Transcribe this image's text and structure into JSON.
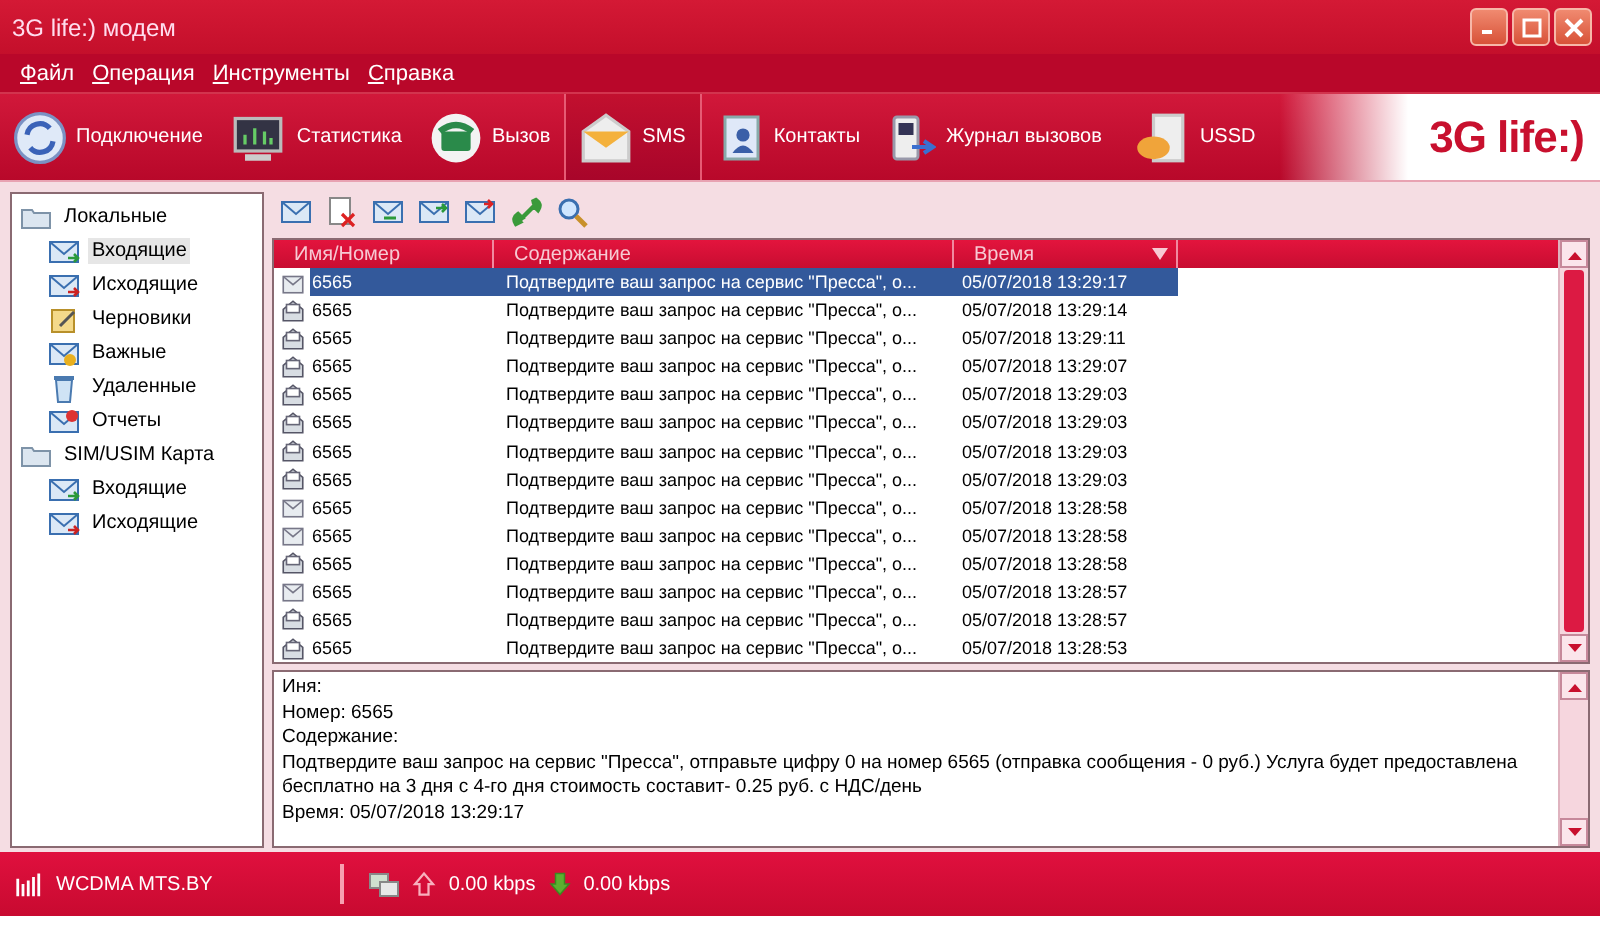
{
  "window": {
    "title": "3G life:) модем"
  },
  "menu": [
    "Файл",
    "Операция",
    "Инструменты",
    "Справка"
  ],
  "toolbar": [
    {
      "label": "Подключение",
      "kind": "connect",
      "selected": false
    },
    {
      "label": "Статистика",
      "kind": "stats",
      "selected": false
    },
    {
      "label": "Вызов",
      "kind": "call",
      "selected": false
    },
    {
      "label": "SMS",
      "kind": "sms",
      "selected": true
    },
    {
      "label": "Контакты",
      "kind": "contacts",
      "selected": false
    },
    {
      "label": "Журнал вызовов",
      "kind": "log",
      "selected": false
    },
    {
      "label": "USSD",
      "kind": "ussd",
      "selected": false
    }
  ],
  "logo": "3G life:)",
  "sidebar": {
    "items": [
      {
        "label": "Локальные",
        "kind": "folder",
        "selected": false,
        "children": [
          {
            "label": "Входящие",
            "kind": "inbox",
            "selected": true
          },
          {
            "label": "Исходящие",
            "kind": "outbox",
            "selected": false
          },
          {
            "label": "Черновики",
            "kind": "drafts",
            "selected": false
          },
          {
            "label": "Важные",
            "kind": "important",
            "selected": false
          },
          {
            "label": "Удаленные",
            "kind": "trash",
            "selected": false
          },
          {
            "label": "Отчеты",
            "kind": "reports",
            "selected": false
          }
        ]
      },
      {
        "label": "SIM/USIM Карта",
        "kind": "folder",
        "selected": false,
        "children": [
          {
            "label": "Входящие",
            "kind": "inbox",
            "selected": false
          },
          {
            "label": "Исходящие",
            "kind": "outbox",
            "selected": false
          }
        ]
      }
    ]
  },
  "table": {
    "columns": [
      "Имя/Номер",
      "Содержание",
      "Время"
    ],
    "rows": [
      {
        "name": "6565",
        "content": "Подтвердите ваш запрос на сервис \"Пресса\", о...",
        "time": "05/07/2018 13:29:17",
        "read": false,
        "selected": true
      },
      {
        "name": "6565",
        "content": "Подтвердите ваш запрос на сервис \"Пресса\", о...",
        "time": "05/07/2018 13:29:14",
        "read": true,
        "selected": false
      },
      {
        "name": "6565",
        "content": "Подтвердите ваш запрос на сервис \"Пресса\", о...",
        "time": "05/07/2018 13:29:11",
        "read": true,
        "selected": false
      },
      {
        "name": "6565",
        "content": "Подтвердите ваш запрос на сервис \"Пресса\", о...",
        "time": "05/07/2018 13:29:07",
        "read": true,
        "selected": false
      },
      {
        "name": "6565",
        "content": "Подтвердите ваш запрос на сервис \"Пресса\", о...",
        "time": "05/07/2018 13:29:03",
        "read": true,
        "selected": false
      },
      {
        "name": "6565",
        "content": "Подтвердите ваш запрос на сервис \"Пресса\", о...",
        "time": "05/07/2018 13:29:03",
        "read": true,
        "selected": false
      },
      {
        "name": "6565",
        "content": "Подтвердите ваш запрос на сервис \"Пресса\", о...",
        "time": "05/07/2018 13:29:03",
        "read": true,
        "selected": false
      },
      {
        "name": "6565",
        "content": "Подтвердите ваш запрос на сервис \"Пресса\", о...",
        "time": "05/07/2018 13:29:03",
        "read": true,
        "selected": false
      },
      {
        "name": "6565",
        "content": "Подтвердите ваш запрос на сервис \"Пресса\", о...",
        "time": "05/07/2018 13:28:58",
        "read": false,
        "selected": false
      },
      {
        "name": "6565",
        "content": "Подтвердите ваш запрос на сервис \"Пресса\", о...",
        "time": "05/07/2018 13:28:58",
        "read": false,
        "selected": false
      },
      {
        "name": "6565",
        "content": "Подтвердите ваш запрос на сервис \"Пресса\", о...",
        "time": "05/07/2018 13:28:58",
        "read": true,
        "selected": false
      },
      {
        "name": "6565",
        "content": "Подтвердите ваш запрос на сервис \"Пресса\", о...",
        "time": "05/07/2018 13:28:57",
        "read": false,
        "selected": false
      },
      {
        "name": "6565",
        "content": "Подтвердите ваш запрос на сервис \"Пресса\", о...",
        "time": "05/07/2018 13:28:57",
        "read": true,
        "selected": false
      },
      {
        "name": "6565",
        "content": "Подтвердите ваш запрос на сервис \"Пресса\", о...",
        "time": "05/07/2018 13:28:53",
        "read": true,
        "selected": false
      }
    ]
  },
  "detail": [
    "Иня:",
    "Номер: 6565",
    "Содержание:",
    "Подтвердите ваш запрос на сервис \"Пресса\", отправьте цифру 0 на номер 6565 (отправка сообщения - 0 руб.) Услуга будет предоставлена бесплатно на 3 дня с 4-го дня стоимость составит- 0.25 руб. с НДС/день",
    "Время: 05/07/2018 13:29:17"
  ],
  "status_bar": {
    "network": "WCDMA MTS.BY",
    "upload": "0.00 kbps",
    "download": "0.00 kbps"
  }
}
